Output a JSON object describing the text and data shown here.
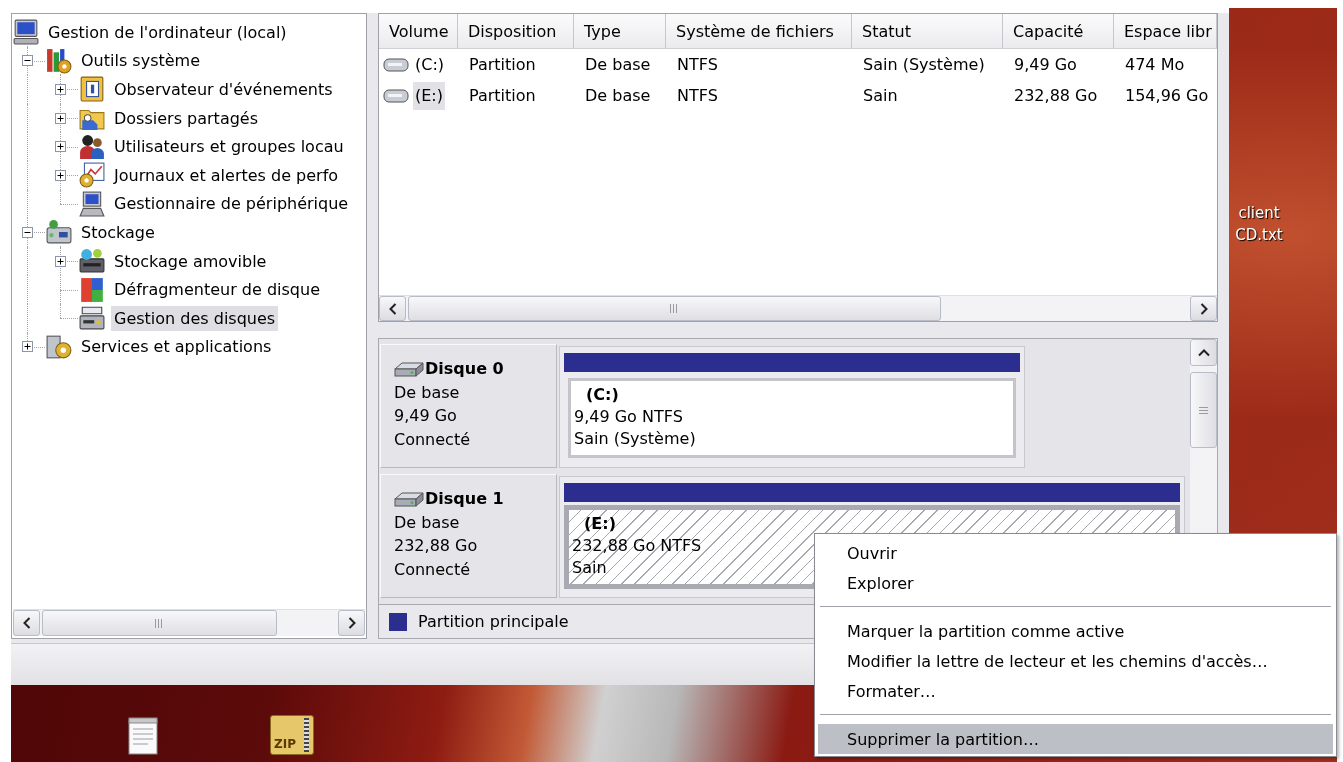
{
  "tree": [
    {
      "label": "Gestion de l'ordinateur (local)",
      "kind": "computer",
      "selected": false,
      "children": [
        {
          "label": "Outils système",
          "kind": "tools",
          "expanded": true,
          "selected": false,
          "children": [
            {
              "label": "Observateur d'événements",
              "kind": "events",
              "expanded": false,
              "selected": false
            },
            {
              "label": "Dossiers partagés",
              "kind": "shares",
              "expanded": false,
              "selected": false
            },
            {
              "label": "Utilisateurs et groupes locau",
              "kind": "users",
              "expanded": false,
              "selected": false
            },
            {
              "label": "Journaux et alertes de perfo",
              "kind": "logs",
              "expanded": false,
              "selected": false
            },
            {
              "label": "Gestionnaire de périphérique",
              "kind": "devices",
              "selected": false
            }
          ]
        },
        {
          "label": "Stockage",
          "kind": "storage",
          "expanded": true,
          "selected": false,
          "children": [
            {
              "label": "Stockage amovible",
              "kind": "removable",
              "expanded": false,
              "selected": false
            },
            {
              "label": "Défragmenteur de disque",
              "kind": "defrag",
              "selected": false
            },
            {
              "label": "Gestion des disques",
              "kind": "disks",
              "selected": true
            }
          ]
        },
        {
          "label": "Services et applications",
          "kind": "services",
          "expanded": false,
          "selected": false
        }
      ]
    }
  ],
  "volume_table": {
    "columns": [
      "Volume",
      "Disposition",
      "Type",
      "Système de fichiers",
      "Statut",
      "Capacité",
      "Espace libr"
    ],
    "rows": [
      {
        "selected": false,
        "cells": [
          "(C:)",
          "Partition",
          "De base",
          "NTFS",
          "Sain (Système)",
          "9,49 Go",
          "474 Mo"
        ]
      },
      {
        "selected": true,
        "cells": [
          "(E:)",
          "Partition",
          "De base",
          "NTFS",
          "Sain",
          "232,88 Go",
          "154,96 Go"
        ]
      }
    ]
  },
  "disks": [
    {
      "name": "Disque 0",
      "type": "De base",
      "size": "9,49 Go",
      "status": "Connecté",
      "partitions": [
        {
          "label": "(C:)",
          "size": "9,49 Go NTFS",
          "status": "Sain (Système)",
          "selected": false
        }
      ]
    },
    {
      "name": "Disque 1",
      "type": "De base",
      "size": "232,88 Go",
      "status": "Connecté",
      "partitions": [
        {
          "label": "(E:)",
          "size": "232,88 Go NTFS",
          "status": "Sain",
          "selected": true
        }
      ]
    }
  ],
  "legend": {
    "label": "Partition principale"
  },
  "context_menu": [
    {
      "kind": "item",
      "label": "Ouvrir",
      "selected": false
    },
    {
      "kind": "item",
      "label": "Explorer",
      "selected": false
    },
    {
      "kind": "separator"
    },
    {
      "kind": "item",
      "label": "Marquer la partition comme active",
      "selected": false
    },
    {
      "kind": "item",
      "label": "Modifier la lettre de lecteur et les chemins d'accès…",
      "selected": false
    },
    {
      "kind": "item",
      "label": "Formater…",
      "selected": false
    },
    {
      "kind": "separator"
    },
    {
      "kind": "item",
      "label": "Supprimer la partition…",
      "selected": true
    }
  ],
  "desktop": {
    "file_label": "client CD.txt",
    "zip_icon_text": "ZIP"
  }
}
